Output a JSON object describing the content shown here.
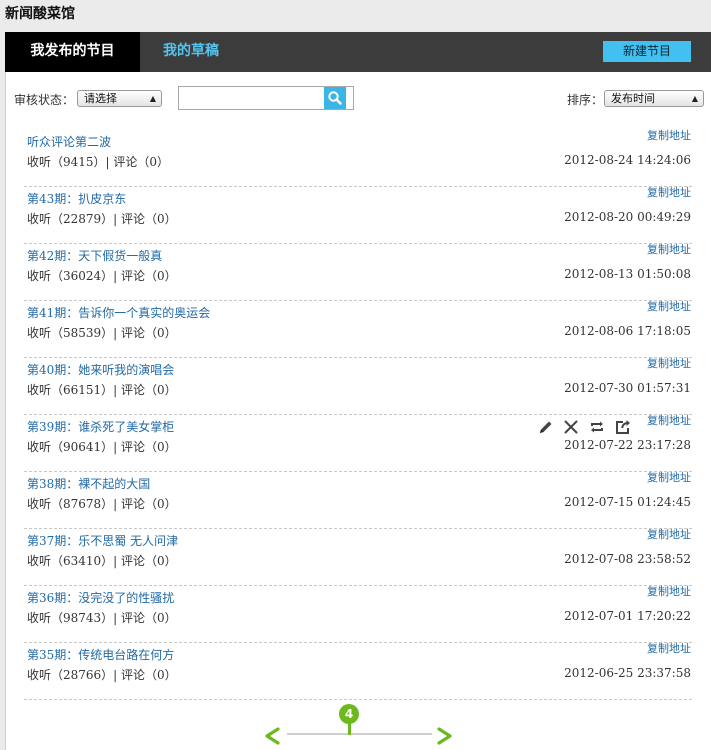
{
  "app": {
    "title": "新闻酸菜馆"
  },
  "tabs": [
    {
      "label": "我发布的节目"
    },
    {
      "label": "我的草稿"
    }
  ],
  "toolbar": {
    "new_label": "新建节目"
  },
  "filter": {
    "status_label": "审核状态：",
    "status_value": "请选择",
    "search_value": "",
    "sort_label": "排序：",
    "sort_value": "发布时间"
  },
  "copy_link_label": "复制地址",
  "items": [
    {
      "title": "听众评论第二波",
      "stats": "收听（9415）| 评论（0）",
      "date": "2012-08-24 14:24:06"
    },
    {
      "title": "第43期：扒皮京东",
      "stats": "收听（22879）| 评论（0）",
      "date": "2012-08-20 00:49:29"
    },
    {
      "title": "第42期：天下假货一般真",
      "stats": "收听（36024）| 评论（0）",
      "date": "2012-08-13 01:50:08"
    },
    {
      "title": "第41期：告诉你一个真实的奥运会",
      "stats": "收听（58539）| 评论（0）",
      "date": "2012-08-06 17:18:05"
    },
    {
      "title": "第40期：她来听我的演唱会",
      "stats": "收听（66151）| 评论（0）",
      "date": "2012-07-30 01:57:31"
    },
    {
      "title": "第39期：谁杀死了美女掌柜",
      "stats": "收听（90641）| 评论（0）",
      "date": "2012-07-22 23:17:28"
    },
    {
      "title": "第38期：裸不起的大国",
      "stats": "收听（87678）| 评论（0）",
      "date": "2012-07-15 01:24:45"
    },
    {
      "title": "第37期：乐不思蜀 无人问津",
      "stats": "收听（63410）| 评论（0）",
      "date": "2012-07-08 23:58:52"
    },
    {
      "title": "第36期：没完没了的性骚扰",
      "stats": "收听（98743）| 评论（0）",
      "date": "2012-07-01 17:20:22"
    },
    {
      "title": "第35期：传统电台路在何方",
      "stats": "收听（28766）| 评论（0）",
      "date": "2012-06-25 23:37:58"
    }
  ],
  "row_actions_on_item": 5,
  "row_action_icons": [
    "pencil-icon",
    "close-icon",
    "repeat-icon",
    "share-icon"
  ],
  "pager": {
    "current_page": "4"
  },
  "colors": {
    "accent": "#42c1f1",
    "link": "#226aa6",
    "pager": "#6cb81e",
    "tabbar": "#3c3c3c"
  }
}
